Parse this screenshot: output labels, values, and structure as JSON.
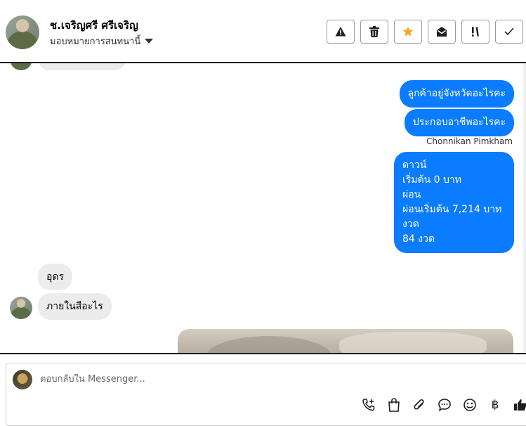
{
  "header": {
    "contact_name": "ช.เจริญศรี ศรีเจริญ",
    "assign_label": "มอบหมายการสนทนานี้",
    "toolbar_icons": [
      "warning-icon",
      "trash-icon",
      "star-icon",
      "envelope-open-icon",
      "important-icon",
      "check-icon"
    ],
    "accent_color": "#f5a623"
  },
  "chat": {
    "out_messages": [
      "ลูกค้าอยู่จังหวัดอะไรคะ",
      "ประกอบอาชีพอะไรคะ"
    ],
    "sender_name": "Chonnikan Pimkham",
    "summary_lines": [
      "ดาวน์",
      "เริ่มต้น 0 บาท",
      "ผ่อน",
      "ผ่อนเริ่มต้น 7,214 บาท",
      "งวด",
      "84 งวด"
    ],
    "in_messages": [
      "อุดร",
      "ภายในสือะไร"
    ],
    "out_bubble_color": "#0a7cff"
  },
  "composer": {
    "placeholder": "ตอบกลับใน Messenger...",
    "icons": [
      "phone-plus-icon",
      "shopping-bag-icon",
      "paperclip-icon",
      "chat-bubble-icon",
      "smiley-icon",
      "baht-icon",
      "thumbs-up-icon"
    ],
    "baht_symbol": "฿"
  }
}
